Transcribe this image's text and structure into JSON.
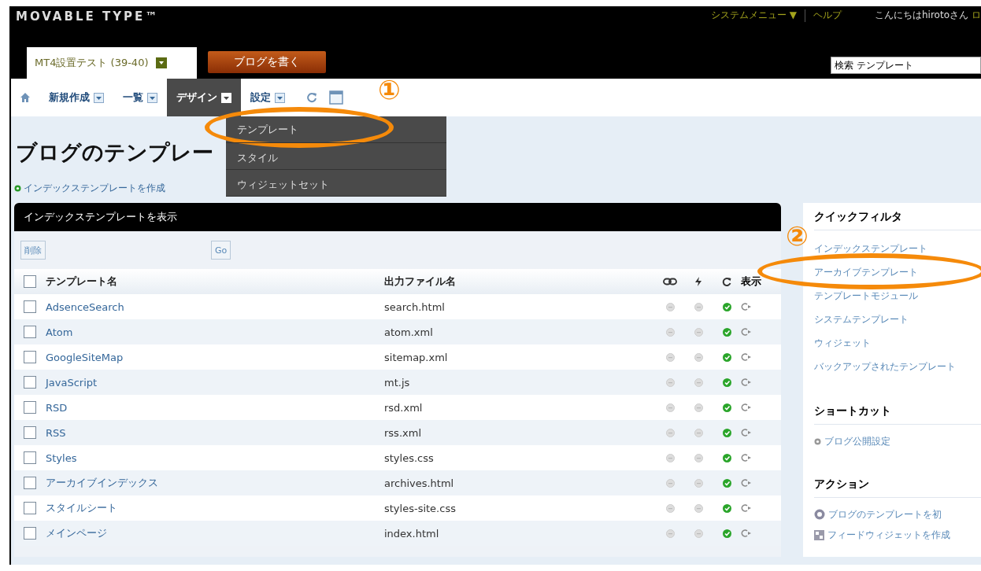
{
  "header": {
    "logo": "MOVABLE TYPE™",
    "top_links": [
      {
        "label": "システムメニュー ▼"
      },
      {
        "label": "ヘルプ"
      }
    ],
    "greeting": "こんにちはhirotoさん",
    "greeting_link": "ロ",
    "blog_selector": "MT4設置テスト (39-40)",
    "write_button": "ブログを書く",
    "search": {
      "value": "検索 テンプレート"
    }
  },
  "nav": [
    {
      "label": "新規作成",
      "selected": false
    },
    {
      "label": "一覧",
      "selected": false
    },
    {
      "label": "デザイン",
      "selected": true
    },
    {
      "label": "設定",
      "selected": false
    }
  ],
  "dropdown": [
    {
      "label": "テンプレート"
    },
    {
      "label": "スタイル"
    },
    {
      "label": "ウィジェットセット"
    }
  ],
  "page_title": "ブログのテンプレー",
  "create_link": "インデックステンプレートを作成",
  "panel": {
    "title": "インデックステンプレートを表示",
    "delete_button": "削除",
    "go_button": "Go",
    "columns": [
      "テンプレート名",
      "出力ファイル名",
      "表示"
    ],
    "select_all_checked": false,
    "rows": [
      {
        "name": "AdsenceSearch",
        "file": "search.html",
        "checked": false,
        "linked": false,
        "build_static": false,
        "build_dynamic": true
      },
      {
        "name": "Atom",
        "file": "atom.xml",
        "checked": false,
        "linked": false,
        "build_static": false,
        "build_dynamic": true
      },
      {
        "name": "GoogleSiteMap",
        "file": "sitemap.xml",
        "checked": false,
        "linked": false,
        "build_static": false,
        "build_dynamic": true
      },
      {
        "name": "JavaScript",
        "file": "mt.js",
        "checked": false,
        "linked": false,
        "build_static": false,
        "build_dynamic": true
      },
      {
        "name": "RSD",
        "file": "rsd.xml",
        "checked": false,
        "linked": false,
        "build_static": false,
        "build_dynamic": true
      },
      {
        "name": "RSS",
        "file": "rss.xml",
        "checked": false,
        "linked": false,
        "build_static": false,
        "build_dynamic": true
      },
      {
        "name": "Styles",
        "file": "styles.css",
        "checked": false,
        "linked": false,
        "build_static": false,
        "build_dynamic": true
      },
      {
        "name": "アーカイブインデックス",
        "file": "archives.html",
        "checked": false,
        "linked": false,
        "build_static": false,
        "build_dynamic": true
      },
      {
        "name": "スタイルシート",
        "file": "styles-site.css",
        "checked": false,
        "linked": false,
        "build_static": false,
        "build_dynamic": true
      },
      {
        "name": "メインページ",
        "file": "index.html",
        "checked": false,
        "linked": false,
        "build_static": false,
        "build_dynamic": true
      }
    ]
  },
  "sidebar": {
    "quick_filter": {
      "title": "クイックフィルタ",
      "items": [
        "インデックステンプレート",
        "アーカイブテンプレート",
        "テンプレートモジュール",
        "システムテンプレート",
        "ウィジェット",
        "バックアップされたテンプレート"
      ]
    },
    "shortcuts": {
      "title": "ショートカット",
      "items": [
        "ブログ公開設定"
      ]
    },
    "actions": {
      "title": "アクション",
      "items": [
        "ブログのテンプレートを初",
        "フィードウィジェットを作成"
      ]
    }
  },
  "annotations": [
    {
      "label": "①"
    },
    {
      "label": "②"
    }
  ]
}
